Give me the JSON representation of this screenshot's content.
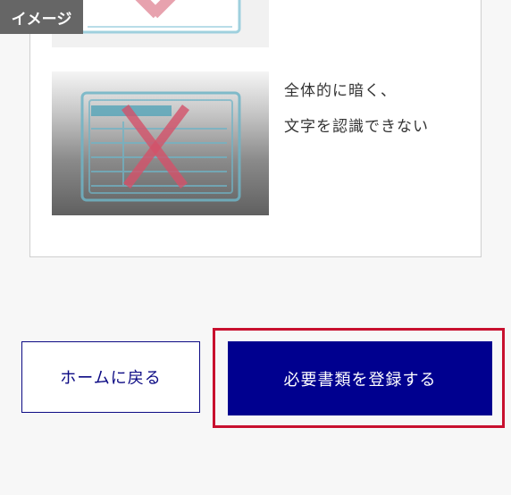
{
  "badge": {
    "label": "イメージ"
  },
  "example": {
    "caption_lines": [
      "全体的に暗く、",
      "文字を認識できない"
    ],
    "mark": "cross-mark-icon"
  },
  "actions": {
    "home_label": "ホームに戻る",
    "register_label": "必要書類を登録する"
  },
  "colors": {
    "primary": "#00008f",
    "highlight": "#c8102e",
    "cross": "#e05a6e",
    "document": "#7fc1d3"
  }
}
